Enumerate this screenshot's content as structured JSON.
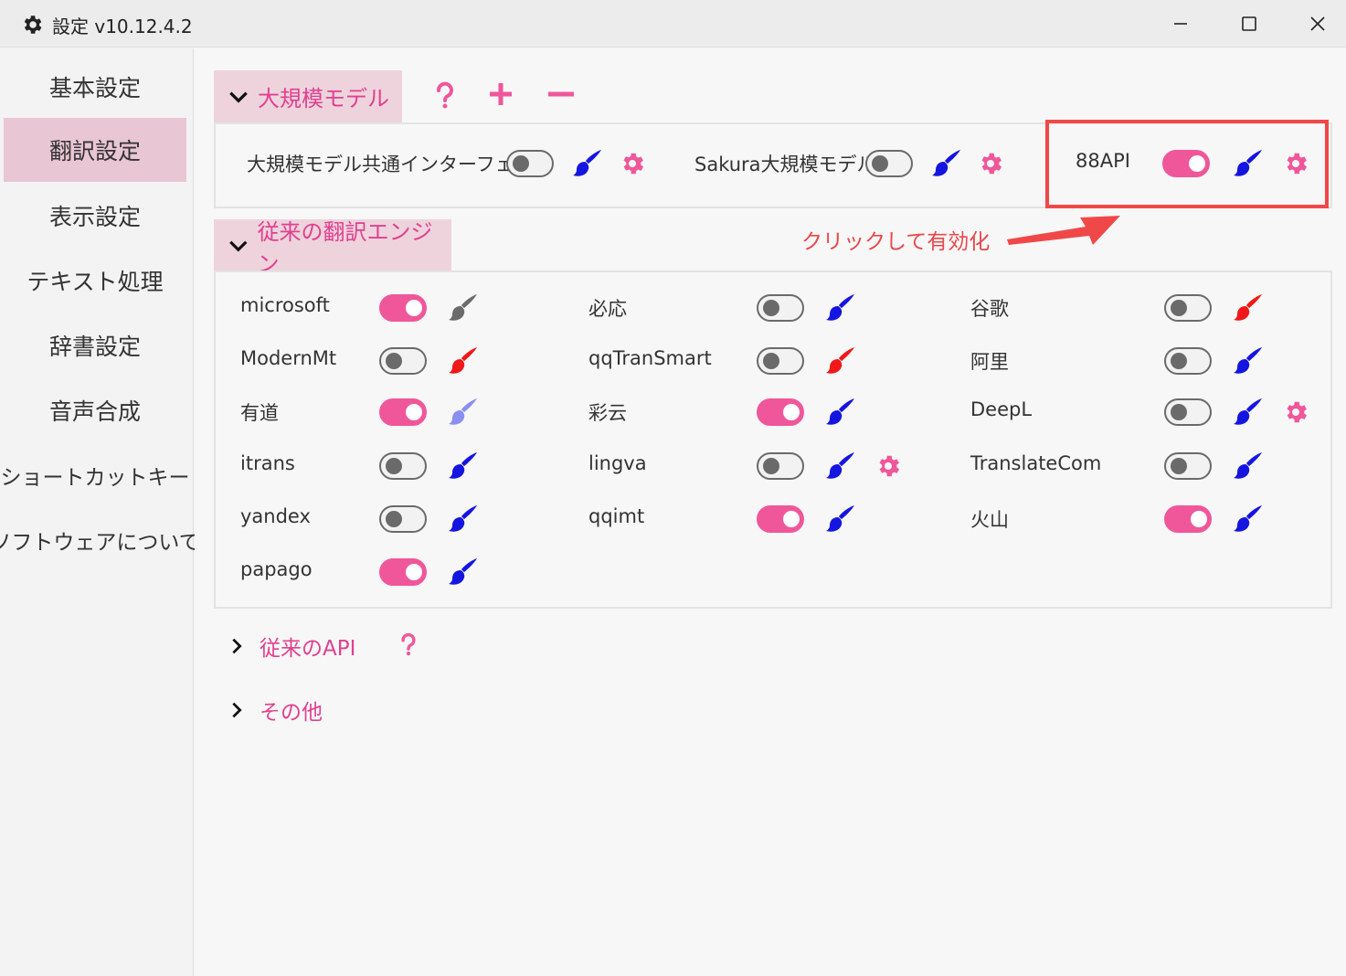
{
  "window": {
    "title": "設定 v10.12.4.2",
    "icon": "gear-icon",
    "controls": [
      "minimize-icon",
      "maximize-icon",
      "close-icon"
    ]
  },
  "sidebar": {
    "items": [
      {
        "label": "基本設定",
        "active": false
      },
      {
        "label": "翻訳設定",
        "active": true
      },
      {
        "label": "表示設定",
        "active": false
      },
      {
        "label": "テキスト処理",
        "active": false
      },
      {
        "label": "辞書設定",
        "active": false
      },
      {
        "label": "音声合成",
        "active": false
      },
      {
        "label": "ショートカットキー",
        "active": false
      },
      {
        "label": "ソフトウェアについて",
        "active": false
      }
    ]
  },
  "llm_section": {
    "title": "大規模モデル",
    "expanded": true,
    "actions": [
      "help-icon",
      "plus-icon",
      "minus-icon"
    ],
    "items": [
      {
        "label": "大規模モデル共通インターフェース",
        "enabled": false,
        "brush_color": "#1515e0",
        "has_settings": true
      },
      {
        "label": "Sakura大規模モデル",
        "enabled": false,
        "brush_color": "#1515e0",
        "has_settings": true
      },
      {
        "label": "88API",
        "enabled": true,
        "brush_color": "#1515e0",
        "has_settings": true
      }
    ]
  },
  "classic_section": {
    "title": "従来の翻訳エンジン",
    "expanded": true,
    "items": [
      {
        "label": "microsoft",
        "enabled": true,
        "brush_color": "#6b6b6b",
        "has_settings": false
      },
      {
        "label": "必応",
        "enabled": false,
        "brush_color": "#1515e0",
        "has_settings": false
      },
      {
        "label": "谷歌",
        "enabled": false,
        "brush_color": "#f01818",
        "has_settings": false
      },
      {
        "label": "ModernMt",
        "enabled": false,
        "brush_color": "#f01818",
        "has_settings": false
      },
      {
        "label": "qqTranSmart",
        "enabled": false,
        "brush_color": "#f01818",
        "has_settings": false
      },
      {
        "label": "阿里",
        "enabled": false,
        "brush_color": "#1515e0",
        "has_settings": false
      },
      {
        "label": "有道",
        "enabled": true,
        "brush_color": "#8a8ff0",
        "has_settings": false
      },
      {
        "label": "彩云",
        "enabled": true,
        "brush_color": "#1515e0",
        "has_settings": false
      },
      {
        "label": "DeepL",
        "enabled": false,
        "brush_color": "#1515e0",
        "has_settings": true
      },
      {
        "label": "itrans",
        "enabled": false,
        "brush_color": "#1515e0",
        "has_settings": false
      },
      {
        "label": "lingva",
        "enabled": false,
        "brush_color": "#1515e0",
        "has_settings": true
      },
      {
        "label": "TranslateCom",
        "enabled": false,
        "brush_color": "#1515e0",
        "has_settings": false
      },
      {
        "label": "yandex",
        "enabled": false,
        "brush_color": "#1515e0",
        "has_settings": false
      },
      {
        "label": "qqimt",
        "enabled": true,
        "brush_color": "#1515e0",
        "has_settings": false
      },
      {
        "label": "火山",
        "enabled": true,
        "brush_color": "#1515e0",
        "has_settings": false
      },
      {
        "label": "papago",
        "enabled": true,
        "brush_color": "#1515e0",
        "has_settings": false
      }
    ]
  },
  "api_section": {
    "title": "従来のAPI",
    "expanded": false,
    "action": "help-icon"
  },
  "other_section": {
    "title": "その他",
    "expanded": false
  },
  "annotation": {
    "text": "クリックして有効化",
    "color": "#e8474b"
  },
  "colors": {
    "accent": "#f0569a",
    "accent_text": "#e0408f",
    "header_bg": "#eed3dd",
    "active_nav": "#e9c6d3"
  }
}
